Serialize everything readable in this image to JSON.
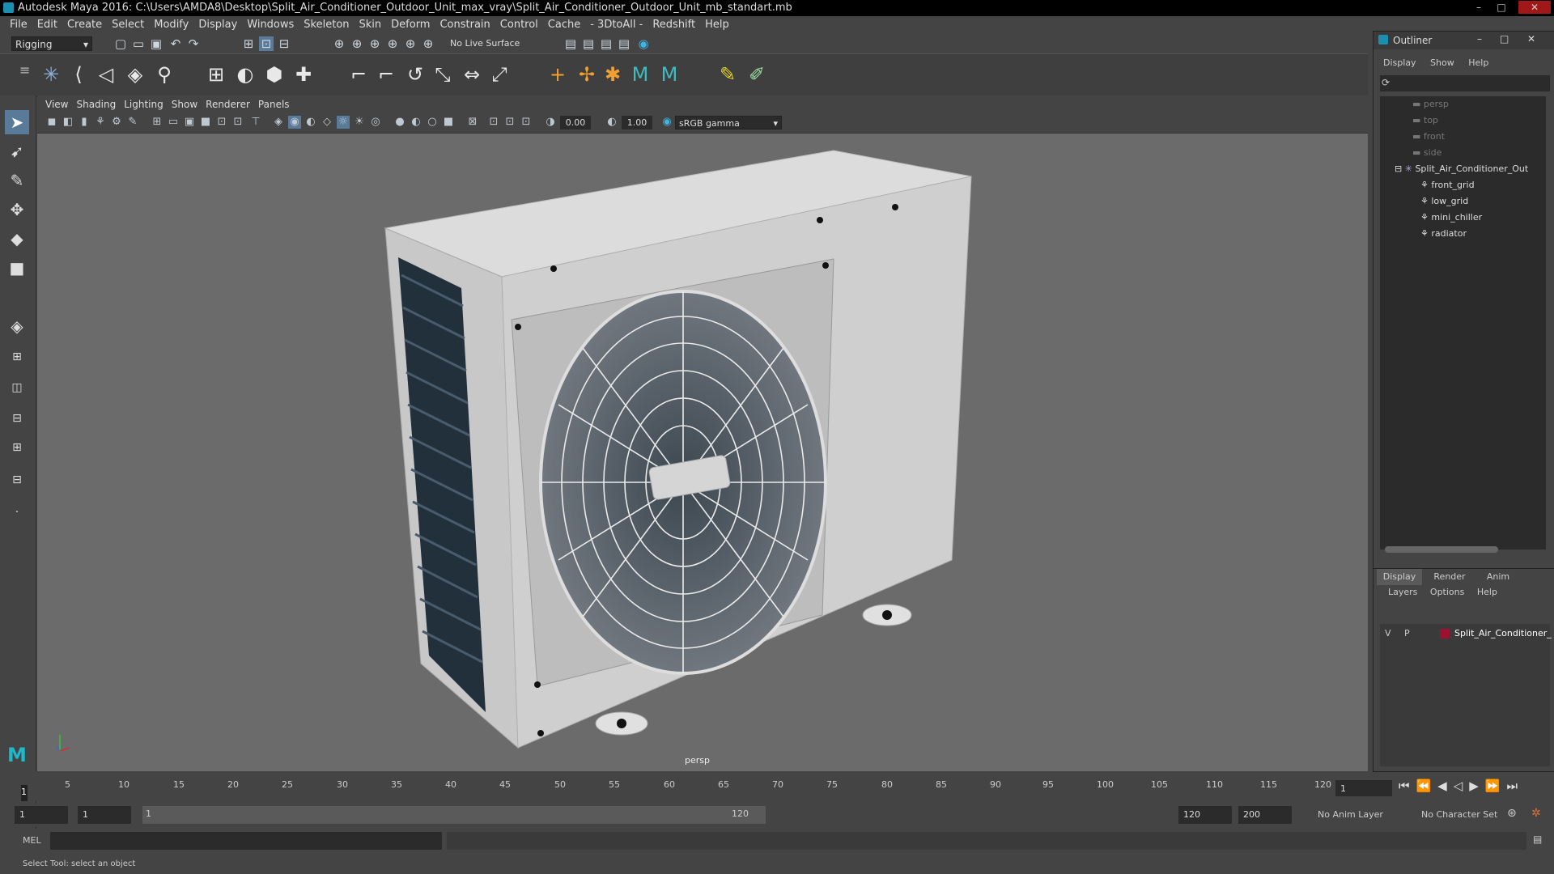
{
  "window": {
    "title": "Autodesk Maya 2016: C:\\Users\\AMDA8\\Desktop\\Split_Air_Conditioner_Outdoor_Unit_max_vray\\Split_Air_Conditioner_Outdoor_Unit_mb_standart.mb"
  },
  "menubar": [
    "File",
    "Edit",
    "Create",
    "Select",
    "Modify",
    "Display",
    "Windows",
    "Skeleton",
    "Skin",
    "Deform",
    "Constrain",
    "Control",
    "Cache",
    "- 3DtoAll -",
    "Redshift",
    "Help"
  ],
  "statusline": {
    "menuset": "Rigging",
    "live_surface": "No Live Surface"
  },
  "viewport": {
    "menu": [
      "View",
      "Shading",
      "Lighting",
      "Show",
      "Renderer",
      "Panels"
    ],
    "exposure": "0.00",
    "gamma": "1.00",
    "colorspace": "sRGB gamma",
    "camera_label": "persp"
  },
  "outliner": {
    "title": "Outliner",
    "menu": [
      "Display",
      "Show",
      "Help"
    ],
    "items": [
      {
        "label": "persp",
        "type": "camera",
        "dim": true
      },
      {
        "label": "top",
        "type": "camera",
        "dim": true
      },
      {
        "label": "front",
        "type": "camera",
        "dim": true
      },
      {
        "label": "side",
        "type": "camera",
        "dim": true
      },
      {
        "label": "Split_Air_Conditioner_Out",
        "type": "group",
        "dim": false
      },
      {
        "label": "front_grid",
        "type": "mesh",
        "dim": false
      },
      {
        "label": "low_grid",
        "type": "mesh",
        "dim": false
      },
      {
        "label": "mini_chiller",
        "type": "mesh",
        "dim": false
      },
      {
        "label": "radiator",
        "type": "mesh",
        "dim": false
      }
    ]
  },
  "layers": {
    "tabs": [
      "Display",
      "Render",
      "Anim"
    ],
    "menu": [
      "Layers",
      "Options",
      "Help"
    ],
    "layer": {
      "v": "V",
      "p": "P",
      "name": "Split_Air_Conditioner_",
      "color": "#9b1230"
    }
  },
  "timeline": {
    "ticks": [
      "5",
      "10",
      "15",
      "20",
      "25",
      "30",
      "35",
      "40",
      "45",
      "50",
      "55",
      "60",
      "65",
      "70",
      "75",
      "80",
      "85",
      "90",
      "95",
      "100",
      "105",
      "110",
      "115",
      "120"
    ],
    "current_frame_marker": "1",
    "current_frame_field": "1"
  },
  "range": {
    "start": "1",
    "playback_start": "1",
    "slider_start": "1",
    "slider_end": "120",
    "playback_end": "120",
    "end": "200",
    "anim_layer": "No Anim Layer",
    "character_set": "No Character Set"
  },
  "cmdline": {
    "label": "MEL"
  },
  "helpline": {
    "text": "Select Tool: select an object"
  }
}
